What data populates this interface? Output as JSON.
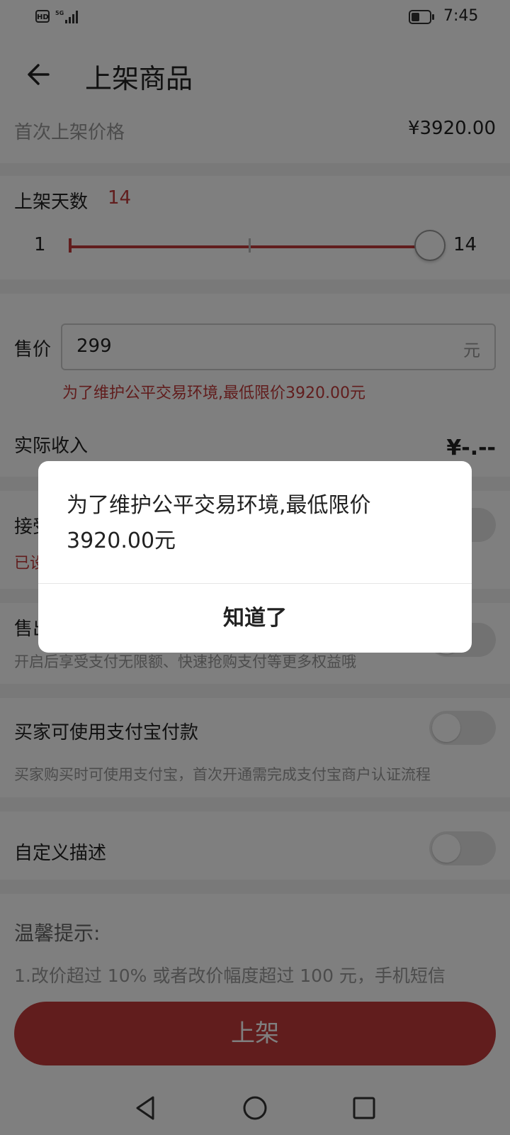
{
  "status_bar": {
    "hd": "HD",
    "signal": "5G",
    "time": "7:45"
  },
  "header": {
    "title": "上架商品"
  },
  "first_price": {
    "label": "首次上架价格",
    "value": "¥3920.00"
  },
  "days": {
    "label": "上架天数",
    "value": "14",
    "min": "1",
    "max": "14",
    "fraction": 1.0
  },
  "price": {
    "label": "售价",
    "value": "299",
    "unit": "元",
    "error": "为了维护公平交易环境,最低限价3920.00元"
  },
  "income": {
    "label": "实际收入",
    "value": "¥-.--"
  },
  "accept_row": {
    "label": "接受",
    "status": "已设"
  },
  "sell_row": {
    "label": "售出",
    "desc": "开启后享受支付无限额、快速抢购支付等更多权益哦"
  },
  "alipay": {
    "label": "买家可使用支付宝付款",
    "desc": "买家购买时可使用支付宝，首次开通需完成支付宝商户认证流程"
  },
  "custom_desc": {
    "label": "自定义描述"
  },
  "tips": {
    "title": "温馨提示:",
    "line1": "1.改价超过 10% 或者改价幅度超过 100 元，手机短信"
  },
  "submit": {
    "label": "上架"
  },
  "dialog": {
    "message": "为了维护公平交易环境,最低限价3920.00元",
    "confirm": "知道了"
  },
  "colors": {
    "accent": "#c23a3a"
  }
}
